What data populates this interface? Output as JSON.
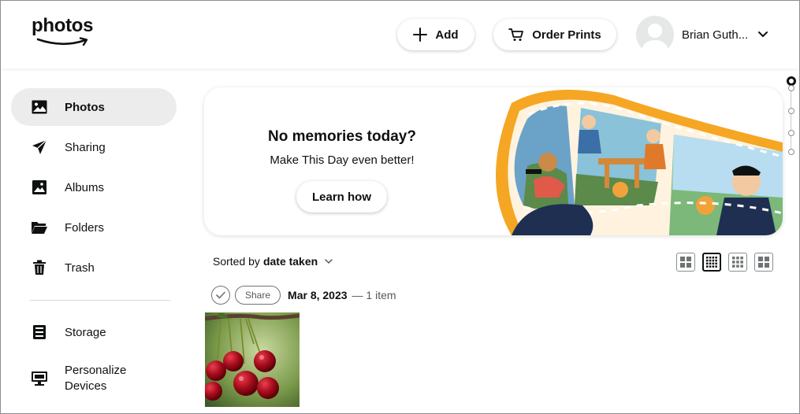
{
  "header": {
    "logo_text": "photos",
    "add_label": "Add",
    "order_prints_label": "Order Prints",
    "user_name": "Brian Guth..."
  },
  "sidebar": {
    "items": [
      {
        "label": "Photos",
        "icon": "photo-icon",
        "active": true
      },
      {
        "label": "Sharing",
        "icon": "paper-plane-icon",
        "active": false
      },
      {
        "label": "Albums",
        "icon": "album-icon",
        "active": false
      },
      {
        "label": "Folders",
        "icon": "folder-icon",
        "active": false
      },
      {
        "label": "Trash",
        "icon": "trash-icon",
        "active": false
      },
      {
        "label": "Storage",
        "icon": "storage-icon",
        "active": false
      },
      {
        "label_line1": "Personalize",
        "label_line2": "Devices",
        "icon": "monitor-icon",
        "active": false
      }
    ]
  },
  "banner": {
    "title": "No memories today?",
    "subtitle": "Make This Day even better!",
    "button_label": "Learn how"
  },
  "toolbar": {
    "sort_prefix": "Sorted by",
    "sort_value": "date taken",
    "views": [
      "large-grid-icon",
      "small-grid-icon",
      "medium-grid-icon",
      "tile-grid-icon"
    ],
    "active_view": 1
  },
  "group": {
    "share_label": "Share",
    "date": "Mar 8, 2023",
    "count": "— 1 item"
  },
  "scrubber": {
    "positions": 4,
    "active": 0
  },
  "colors": {
    "accent_orange": "#f5a623",
    "text_primary": "#0f1111",
    "text_secondary": "#565959",
    "active_nav_bg": "#ececec"
  }
}
